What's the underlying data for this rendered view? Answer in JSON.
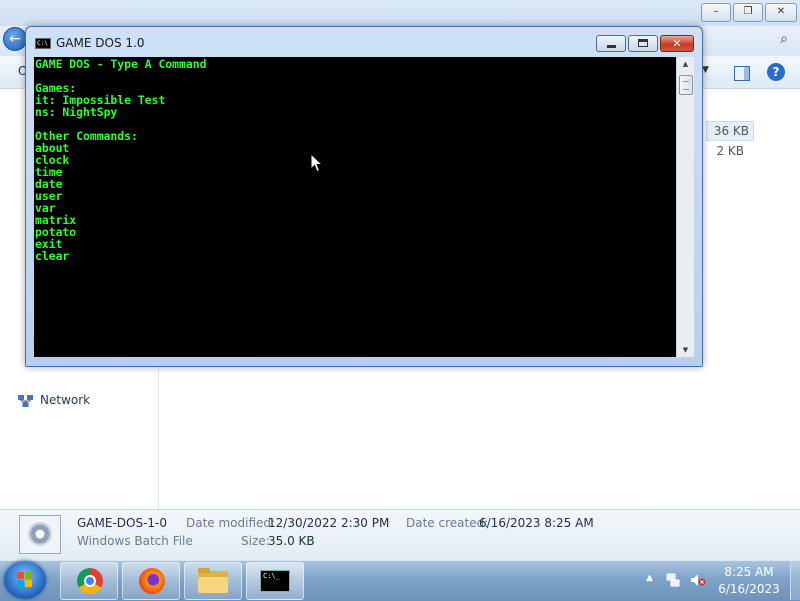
{
  "console": {
    "title": "GAME DOS 1.0",
    "icon_label": "C:\\",
    "lines": [
      "GAME DOS - Type A Command",
      "Games:",
      "it: Impossible Test",
      "ns: NightSpy",
      "Other Commands:",
      "about",
      "clock",
      "time",
      "date",
      "user",
      "var",
      "matrix",
      "potato",
      "exit",
      "clear"
    ],
    "text_color": "#2cff2c",
    "close_glyph": "✕"
  },
  "explorer": {
    "organize_label": "O",
    "back_glyph": "←",
    "search_glyph": "⌕",
    "view_dropdown_glyph": "▼",
    "help_glyph": "?",
    "nav": {
      "network_label": "Network"
    },
    "file_sizes": [
      "36 KB",
      "2 KB"
    ],
    "details": {
      "file_name": "GAME-DOS-1-0",
      "file_type": "Windows Batch File",
      "date_modified_label": "Date modified:",
      "date_modified_value": "12/30/2022 2:30 PM",
      "size_label": "Size:",
      "size_value": "35.0 KB",
      "date_created_label": "Date created:",
      "date_created_value": "6/16/2023 8:25 AM"
    },
    "caption_buttons": [
      "–",
      "❐",
      "✕"
    ]
  },
  "taskbar": {
    "pinned": [
      "chrome-icon",
      "firefox-icon",
      "folder-icon",
      "command-prompt-icon"
    ],
    "cmd_icon_label": "C:\\_",
    "tray_chevron": "▲",
    "clock_time": "8:25 AM",
    "clock_date": "6/16/2023"
  }
}
